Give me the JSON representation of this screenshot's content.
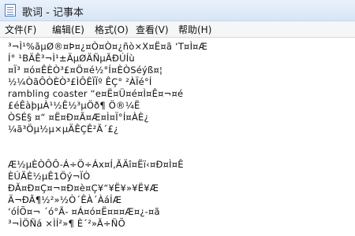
{
  "window": {
    "title": "歌词 - 记事本",
    "icon": "notepad-icon"
  },
  "menu": [
    {
      "label": "文件(F)"
    },
    {
      "label": "编辑(E)"
    },
    {
      "label": "格式(O)"
    },
    {
      "label": "查看(V)"
    },
    {
      "label": "帮助(H)"
    }
  ],
  "editor": {
    "lines": [
      "³¬Ì¹%ãµØ®¤Þ¤¿¤Ò¤Ò¤¿ñò×X¤Ë¤ã ‘T¤Ì¤Æ",
      "Í° ¹BÄÊ³¬Ì¹±ÄµØÄÑµÃÐÚÍù",
      "¤Ï³ ¤ó¤ÊÈÒ³£¤Ö¤é½°Í¤ÈÒSéýß¤¦",
      "½¼ÒãÔÒÈÒ³£ÌÔÊÏÏº ÊÇ° ²ÀÏé°Í",
      "rambling coaster “e¤Ë¤Ü¤é¤Ì¤Ê¤¬¤é",
      "£éÊàþµÀ¹½Ê½³µÖð¶ Ö®¼Ë",
      "ÒSÉ§ ¤“ ¤Ë¤Ð¤Ã¤Æ¤Ì¤Ï°Í¤ÀÈ¿",
      "¼ã³Öµ½µ×µÄÊÇÊ²Ã´£¿",
      "",
      "",
      "Æ½µÈÒÔÔ-Á÷Ö÷Áx¤Í,ÃÄî¤Ëï‹¤Ð¤Ì¤Ê",
      "ÈÚÃÈ½µÊ1Öý¬ÏÒ",
      "ÐÃ¤Ð¤Ç¤¬¤Ð¤è¤Ç¥“¥Ë¥»¥Ë¥Æ",
      "Ä¬ÐÃ¶½²»½Ò´ÊÀ´ÀáÍÆ",
      "‘óÍÕ¤¬ ´ó°Ã‐ ¤Á¤ó¤Ë¤¤¤Æ¤¿‐¤ã",
      "³¬ÌÖÑá ×ÌÍ²»¶ È´²»Ã÷ÑÕ"
    ]
  }
}
